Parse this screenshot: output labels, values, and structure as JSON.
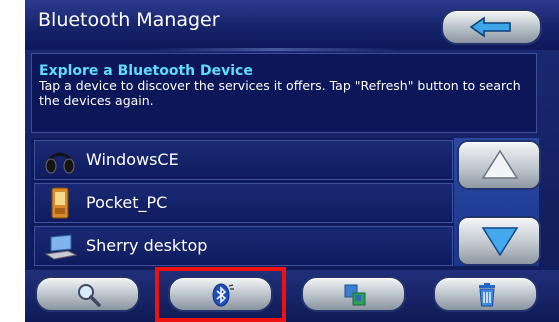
{
  "window": {
    "title": "Bluetooth Manager"
  },
  "info": {
    "heading": "Explore a Bluetooth Device",
    "body": "Tap a device to discover the services it offers. Tap \"Refresh\" button to search the devices again."
  },
  "devices": [
    {
      "name": "WindowsCE",
      "icon": "headset-icon"
    },
    {
      "name": "Pocket_PC",
      "icon": "pda-icon"
    },
    {
      "name": "Sherry desktop",
      "icon": "laptop-icon"
    }
  ],
  "toolbar": {
    "highlighted": "bluetooth-refresh-button"
  },
  "colors": {
    "highlight": "#ee1111",
    "heading": "#5fdcff",
    "background": "#0f1a5d"
  }
}
